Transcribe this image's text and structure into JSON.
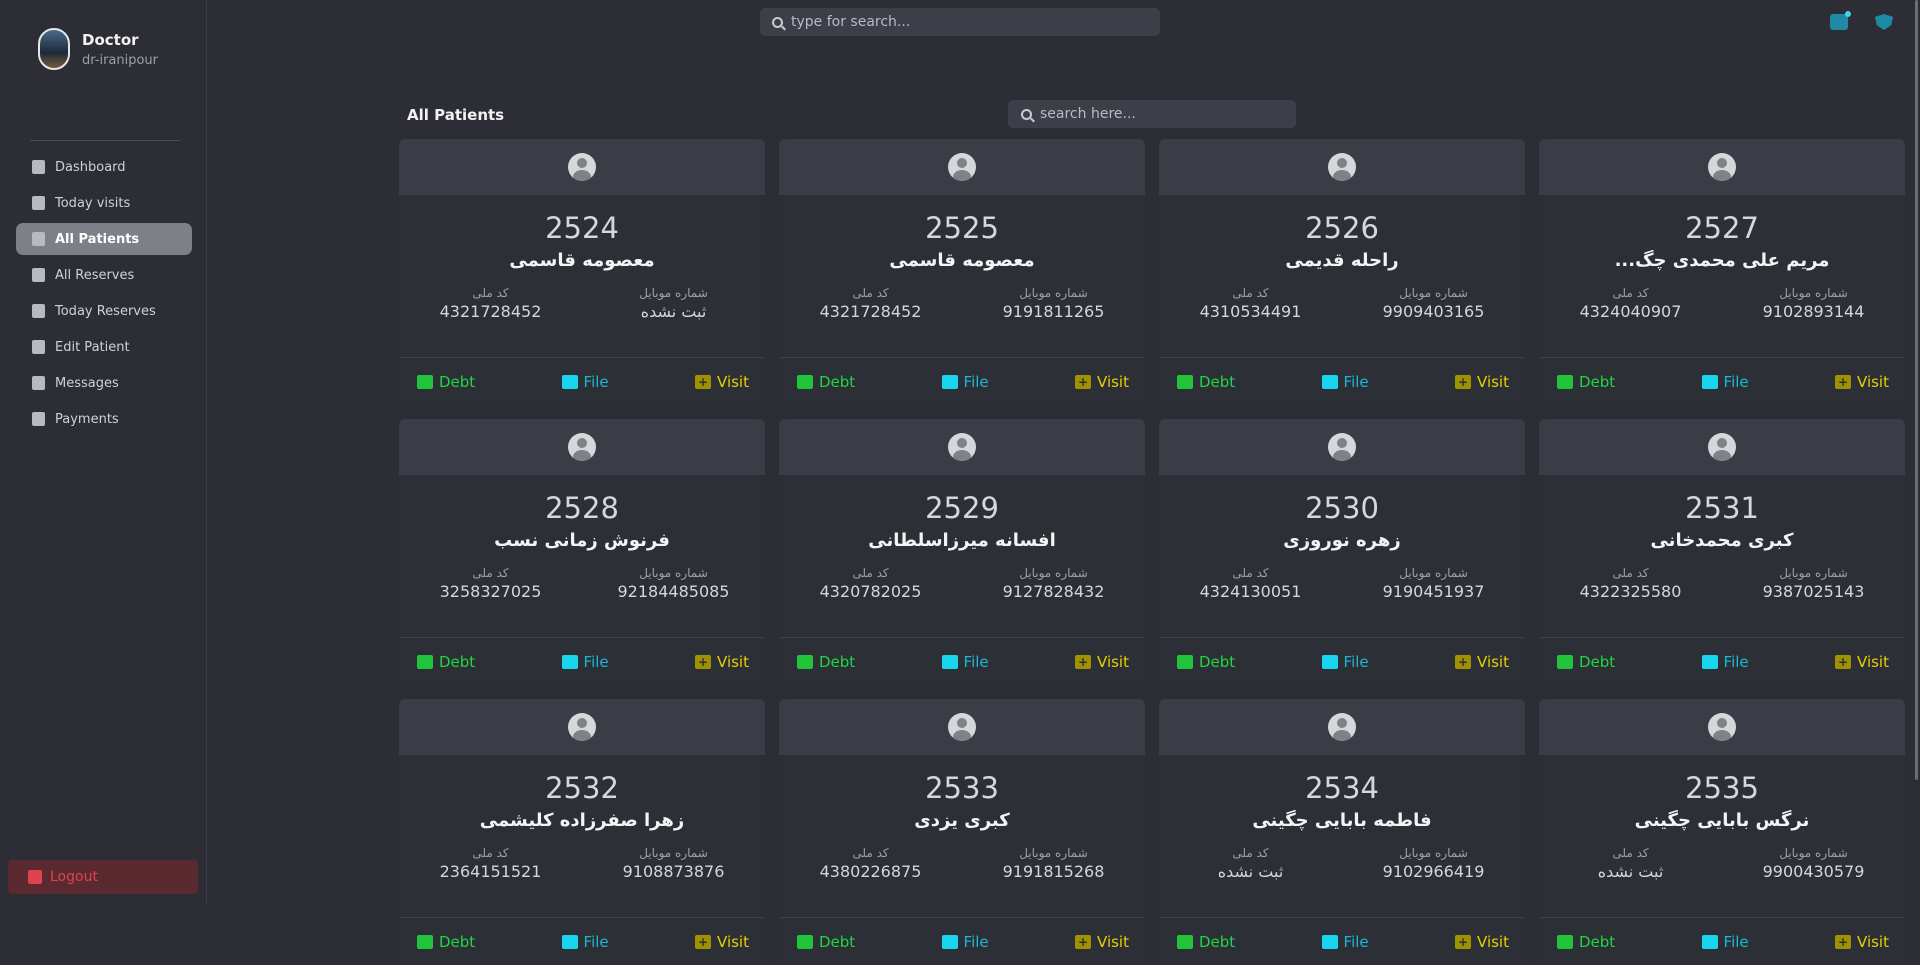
{
  "profile": {
    "name": "Doctor",
    "username": "dr-iranipour"
  },
  "sidebar": {
    "items": [
      {
        "label": "Dashboard",
        "icon": "dashboard-icon",
        "active": false
      },
      {
        "label": "Today visits",
        "icon": "calendar-icon",
        "active": false
      },
      {
        "label": "All Patients",
        "icon": "folder-icon",
        "active": true
      },
      {
        "label": "All Reserves",
        "icon": "calendar-icon",
        "active": false
      },
      {
        "label": "Today Reserves",
        "icon": "calendar-icon",
        "active": false
      },
      {
        "label": "Edit Patient",
        "icon": "edit-icon",
        "active": false
      },
      {
        "label": "Messages",
        "icon": "message-icon",
        "active": false
      },
      {
        "label": "Payments",
        "icon": "card-icon",
        "active": false
      }
    ],
    "logout_label": "Logout"
  },
  "header": {
    "search_placeholder": "type for search...",
    "icons": [
      "mail-icon",
      "shield-icon"
    ]
  },
  "main": {
    "title": "All Patients",
    "search_placeholder": "search here...",
    "labels": {
      "mobile": "شماره موبایل",
      "national_id": "کد ملی"
    },
    "actions": {
      "debt": "Debt",
      "file": "File",
      "visit": "Visit"
    },
    "patients": [
      {
        "code": "2524",
        "name": "معصومه قاسمی",
        "mobile": "ثبت نشده",
        "national_id": "4321728452"
      },
      {
        "code": "2525",
        "name": "معصومه قاسمی",
        "mobile": "9191811265",
        "national_id": "4321728452"
      },
      {
        "code": "2526",
        "name": "راحله قدیمی",
        "mobile": "9909403165",
        "national_id": "4310534491"
      },
      {
        "code": "2527",
        "name": "مریم علی محمدی چگ...",
        "mobile": "9102893144",
        "national_id": "4324040907"
      },
      {
        "code": "2528",
        "name": "فرنوش زمانی نسب",
        "mobile": "92184485085",
        "national_id": "3258327025"
      },
      {
        "code": "2529",
        "name": "افسانه میرزاسلطانی",
        "mobile": "9127828432",
        "national_id": "4320782025"
      },
      {
        "code": "2530",
        "name": "زهره نوروزی",
        "mobile": "9190451937",
        "national_id": "4324130051"
      },
      {
        "code": "2531",
        "name": "کبری محمدخانی",
        "mobile": "9387025143",
        "national_id": "4322325580"
      },
      {
        "code": "2532",
        "name": "زهرا صفرزاده کلیشمی",
        "mobile": "9108873876",
        "national_id": "2364151521"
      },
      {
        "code": "2533",
        "name": "کبری یزدی",
        "mobile": "9191815268",
        "national_id": "4380226875"
      },
      {
        "code": "2534",
        "name": "فاطمه بابایی چگینی",
        "mobile": "9102966419",
        "national_id": "ثبت نشده"
      },
      {
        "code": "2535",
        "name": "نرگس بابایی چگینی",
        "mobile": "9900430579",
        "national_id": "ثبت نشده"
      }
    ]
  },
  "colors": {
    "debt": "#21d63f",
    "file": "#1bb7d4",
    "visit": "#e6d000",
    "logout": "#e0414e",
    "active_nav": "#7d8087"
  }
}
